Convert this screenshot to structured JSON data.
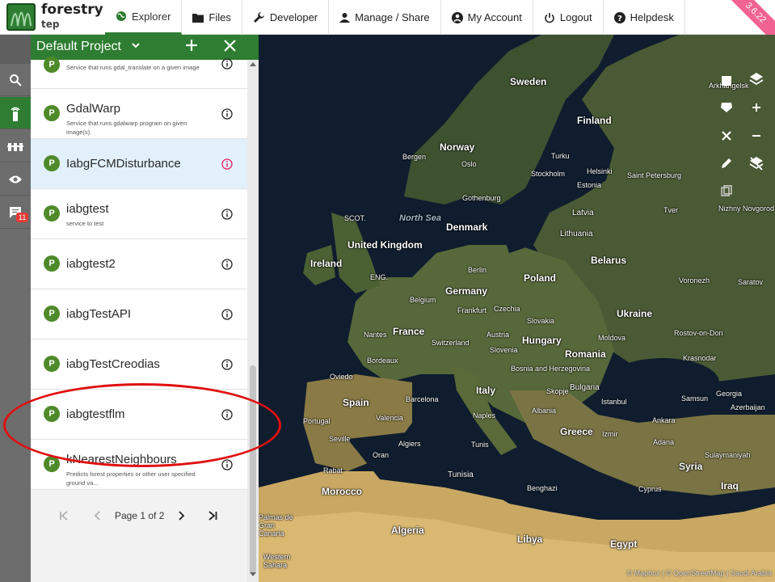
{
  "brand": {
    "name": "forestry",
    "sub": "tep"
  },
  "nav": [
    {
      "label": "Explorer",
      "icon": "globe-icon",
      "active": true
    },
    {
      "label": "Files",
      "icon": "folder-icon"
    },
    {
      "label": "Developer",
      "icon": "wrench-icon"
    },
    {
      "label": "Manage / Share",
      "icon": "user-icon"
    },
    {
      "label": "My Account",
      "icon": "account-circle-icon"
    },
    {
      "label": "Logout",
      "icon": "power-icon"
    },
    {
      "label": "Helpdesk",
      "icon": "help-icon"
    }
  ],
  "version": "3.6.22",
  "rail": {
    "badge": "11"
  },
  "panel": {
    "title": "Default Project",
    "items": [
      {
        "name": "",
        "desc": "Service that runs gdal_translate on a given image"
      },
      {
        "name": "GdalWarp",
        "desc": "Service that runs gdalwarp program on given image(s)."
      },
      {
        "name": "IabgFCMDisturbance",
        "desc": ""
      },
      {
        "name": "iabgtest",
        "desc": "service to test"
      },
      {
        "name": "iabgtest2",
        "desc": ""
      },
      {
        "name": "iabgTestAPI",
        "desc": ""
      },
      {
        "name": "iabgTestCreodias",
        "desc": ""
      },
      {
        "name": "iabgtestflm",
        "desc": ""
      },
      {
        "name": "kNearestNeighbours",
        "desc": "Predicts forest properties or other user specified ground va..."
      }
    ],
    "badge_letter": "P",
    "pager": {
      "text": "Page 1 of 2"
    }
  },
  "map": {
    "places": [
      "Sweden",
      "Finland",
      "Norway",
      "Bergen",
      "Oslo",
      "Turku",
      "Helsinki",
      "Stockholm",
      "Saint Petersburg",
      "Estonia",
      "Gothenburg",
      "Arkhangelsk",
      "Latvia",
      "Tver",
      "Nizhny Novgorod",
      "North Sea",
      "SCOT.",
      "Denmark",
      "United Kingdom",
      "Lithuania",
      "Ireland",
      "ENG.",
      "Berlin",
      "Belarus",
      "Poland",
      "Voronezh",
      "Saratov",
      "Germany",
      "Belgium",
      "Frankfurt",
      "Czechia",
      "Ukraine",
      "Slovakia",
      "Nantes",
      "France",
      "Austria",
      "Hungary",
      "Moldova",
      "Rostov-on-Don",
      "Switzerland",
      "Slovenia",
      "Romania",
      "Krasnodar",
      "Bordeaux",
      "Bosnia and Herzegovina",
      "Oviedo",
      "Italy",
      "Skopje",
      "Bulgaria",
      "Georgia",
      "Spain",
      "Barcelona",
      "Istanbul",
      "Samsun",
      "Azerbaijan",
      "Portugal",
      "Valencia",
      "Naples",
      "Albania",
      "Ankara",
      "Greece",
      "Seville",
      "Algiers",
      "Tunis",
      "Izmir",
      "Adana",
      "Sulaymaniyah",
      "Rabat",
      "Oran",
      "Tunisia",
      "Syria",
      "Morocco",
      "Benghazi",
      "Cyprus",
      "Iraq",
      "Algeria",
      "Palmas de Gran Canaria",
      "Libya",
      "Egypt",
      "Western Sahara",
      "Saudi Arabia"
    ],
    "attribution": "© Mapbox | © OpenStreetMap | Saudi Arabia"
  }
}
